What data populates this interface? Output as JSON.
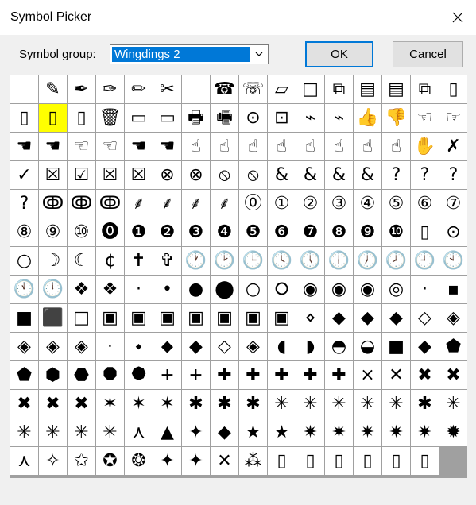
{
  "window": {
    "title": "Symbol Picker"
  },
  "form": {
    "group_label": "Symbol group:",
    "group_value": "Wingdings 2"
  },
  "buttons": {
    "ok": "OK",
    "cancel": "Cancel"
  },
  "icons": {
    "close": "close-icon",
    "dropdown": "chevron-down-icon"
  },
  "colors": {
    "selection": "#0078d7",
    "highlight": "#ffff00",
    "selected_outline": "#0000c0"
  },
  "selected_index": 231,
  "highlight_index": 17,
  "symbols": [
    "",
    "✎",
    "✒",
    "✑",
    "✏",
    "✂",
    "",
    "☎",
    "☏",
    "▱",
    "□",
    "⧉",
    "▤",
    "▤",
    "⧉",
    "▯",
    "▯",
    "▯",
    "▯",
    "🗑",
    "▭",
    "▭",
    "🖶",
    "🖷",
    "⊙",
    "⊡",
    "⌁",
    "⌁",
    "👍",
    "👎",
    "☜",
    "☞",
    "☚",
    "☚",
    "☜",
    "☜",
    "☚",
    "☚",
    "☝",
    "☝",
    "☝",
    "☝",
    "☝",
    "☝",
    "☝",
    "☝",
    "✋",
    "✗",
    "✓",
    "☒",
    "☑",
    "☒",
    "☒",
    "⊗",
    "⊗",
    "⦸",
    "⦸",
    "&",
    "&",
    "&",
    "&",
    "?",
    "?",
    "?",
    "?",
    "ↂ",
    "ↂ",
    "ↂ",
    "⸙",
    "⸙",
    "⸙",
    "⸙",
    "⓪",
    "①",
    "②",
    "③",
    "④",
    "⑤",
    "⑥",
    "⑦",
    "⑧",
    "⑨",
    "⑩",
    "⓿",
    "❶",
    "❷",
    "❸",
    "❹",
    "❺",
    "❻",
    "❼",
    "❽",
    "❾",
    "❿",
    "▯",
    "⊙",
    "○",
    "☽",
    "☾",
    "¢",
    "✝",
    "✞",
    "🕐",
    "🕑",
    "🕒",
    "🕓",
    "🕔",
    "🕕",
    "🕖",
    "🕗",
    "🕘",
    "🕙",
    "🕚",
    "🕛",
    "❖",
    "❖",
    "·",
    "•",
    "●",
    "⬤",
    "○",
    "⭘",
    "◉",
    "◉",
    "◉",
    "◎",
    "·",
    "▪",
    "■",
    "⬛",
    "□",
    "▣",
    "▣",
    "▣",
    "▣",
    "▣",
    "▣",
    "▣",
    "⋄",
    "◆",
    "◆",
    "◆",
    "◇",
    "◈",
    "◈",
    "◈",
    "◈",
    "⋅",
    "⬩",
    "⬥",
    "◆",
    "◇",
    "◈",
    "◖",
    "◗",
    "◓",
    "◒",
    "■",
    "◆",
    "⬟",
    "⬟",
    "⬢",
    "⬣",
    "⯃",
    "⯄",
    "+",
    "+",
    "✚",
    "✚",
    "✚",
    "✚",
    "✚",
    "×",
    "✕",
    "✖",
    "✖",
    "✖",
    "✖",
    "✖",
    "✶",
    "✶",
    "✶",
    "✱",
    "✱",
    "✱",
    "✳",
    "✳",
    "✳",
    "✳",
    "✳",
    "✱",
    "✳",
    "✳",
    "✳",
    "✳",
    "✳",
    "⋏",
    "▲",
    "✦",
    "◆",
    "★",
    "★",
    "✷",
    "✷",
    "✷",
    "✷",
    "✷",
    "✹",
    "⋏",
    "✧",
    "✩",
    "✪",
    "❂",
    "✦",
    "✦",
    "✕",
    "⁂",
    "▯",
    "▯",
    "▯",
    "▯",
    "▯",
    "▯"
  ]
}
